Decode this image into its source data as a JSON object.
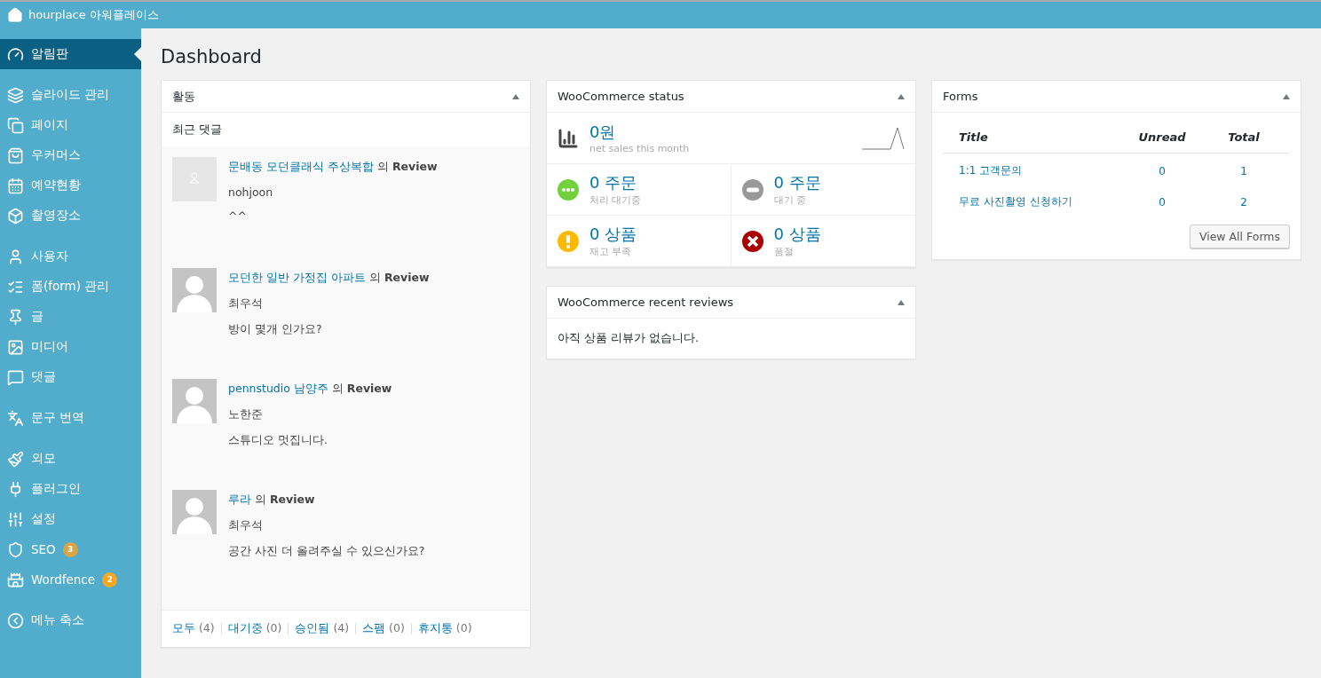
{
  "topbar": {
    "site": "hourplace 아워플레이스"
  },
  "sidebar": {
    "groups": [
      [
        {
          "label": "알림판",
          "selected": true
        }
      ],
      [
        {
          "label": "슬라이드 관리",
          "selected": false
        },
        {
          "label": "페이지",
          "selected": false
        },
        {
          "label": "우커머스",
          "selected": false
        },
        {
          "label": "예약현황",
          "selected": false
        },
        {
          "label": "촬영장소",
          "selected": false
        }
      ],
      [
        {
          "label": "사용자",
          "selected": false
        },
        {
          "label": "폼(form) 관리",
          "selected": false
        },
        {
          "label": "글",
          "selected": false
        },
        {
          "label": "미디어",
          "selected": false
        },
        {
          "label": "댓글",
          "selected": false
        }
      ],
      [
        {
          "label": "문구 번역",
          "selected": false
        }
      ],
      [
        {
          "label": "외모",
          "selected": false
        },
        {
          "label": "플러그인",
          "selected": false
        },
        {
          "label": "설정",
          "selected": false
        },
        {
          "label": "SEO",
          "selected": false,
          "badge": "3",
          "color": "#d9a443"
        },
        {
          "label": "Wordfence",
          "selected": false,
          "badge": "2",
          "color": "#f5a623"
        }
      ],
      [
        {
          "label": "메뉴 축소",
          "selected": false
        }
      ]
    ]
  },
  "page_title": "Dashboard",
  "activity": {
    "title": "활동",
    "subtitle": "최근 댓글",
    "comments": [
      {
        "kind": "placeholder",
        "post": "문배동 모던클래식 주상복합",
        "rest": "의 **Review**",
        "author": "nohjoon",
        "text": "^^"
      },
      {
        "kind": "default",
        "post": "모던한 일반 가정집 아파트",
        "rest": "의 **Review**",
        "author": "최우석",
        "text": "방이 몇개 인가요?"
      },
      {
        "kind": "default",
        "post": "pennstudio 남양주",
        "rest": "의 **Review**",
        "author": "노한준",
        "text": "스튜디오 멋집니다."
      },
      {
        "kind": "default",
        "post": "루라",
        "rest": "의 **Review**",
        "author": "최우석",
        "text": "공간 사진 더 올려주실 수 있으신가요?"
      }
    ],
    "filters": [
      {
        "label": "모두",
        "count": "(4)"
      },
      {
        "label": "대기중",
        "count": "(0)"
      },
      {
        "label": "승인됨",
        "count": "(4)"
      },
      {
        "label": "스팸",
        "count": "(0)"
      },
      {
        "label": "휴지통",
        "count": "(0)"
      }
    ]
  },
  "woo_status": {
    "title": "WooCommerce status",
    "sales": {
      "amount": "0원",
      "caption": "net sales this month"
    },
    "cells": [
      {
        "kind": "processing",
        "value": "0 주문",
        "caption": "처리 대기중"
      },
      {
        "kind": "on-hold",
        "value": "0 주문",
        "caption": "대기 중"
      },
      {
        "kind": "low-stock",
        "value": "0 상품",
        "caption": "재고 부족"
      },
      {
        "kind": "out-of-stock",
        "value": "0 상품",
        "caption": "품절"
      }
    ]
  },
  "woo_reviews": {
    "title": "WooCommerce recent reviews",
    "message": "아직 상품 리뷰가 없습니다."
  },
  "forms": {
    "title": "Forms",
    "columns": [
      "Title",
      "Unread",
      "Total"
    ],
    "rows": [
      [
        "1:1 고객문의",
        "0",
        "1"
      ],
      [
        "무료 사진촬영 신청하기",
        "0",
        "2"
      ]
    ],
    "button": "View All Forms"
  }
}
